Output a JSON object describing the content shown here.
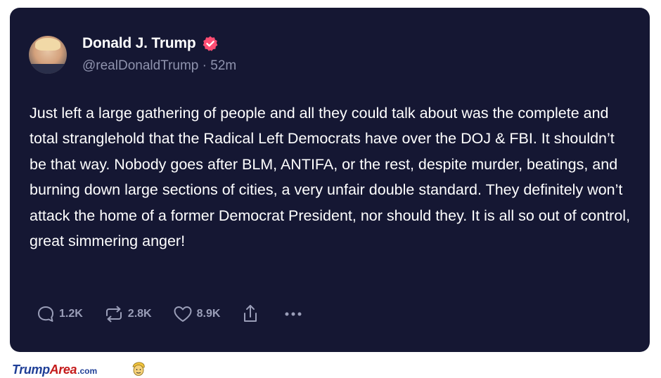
{
  "post": {
    "author_name": "Donald J. Trump",
    "handle_line": "@realDonaldTrump · 52m",
    "text": "Just left a large gathering of people and all they could talk about was the complete and total stranglehold that the Radical Left Democrats have over the DOJ & FBI. It shouldn’t be that way. Nobody goes after BLM, ANTIFA, or the rest, despite murder, beatings, and burning down large sections of cities, a very unfair double standard. They definitely won’t attack the home of a former Democrat President, nor should they. It is all so out of control, great simmering anger!"
  },
  "actions": {
    "replies": "1.2K",
    "reposts": "2.8K",
    "likes": "8.9K"
  },
  "icons": [
    "verified-badge-icon",
    "reply-icon",
    "repost-icon",
    "like-icon",
    "share-icon",
    "more-icon"
  ],
  "watermark": {
    "part1": "Trump",
    "part2": "Area",
    "part3": ".com"
  },
  "colors": {
    "card_background": "#151733",
    "verified_badge": "#ff4d73",
    "muted_text": "#8f93ae",
    "watermark_blue": "#1f3f97",
    "watermark_red": "#c41a1a"
  }
}
